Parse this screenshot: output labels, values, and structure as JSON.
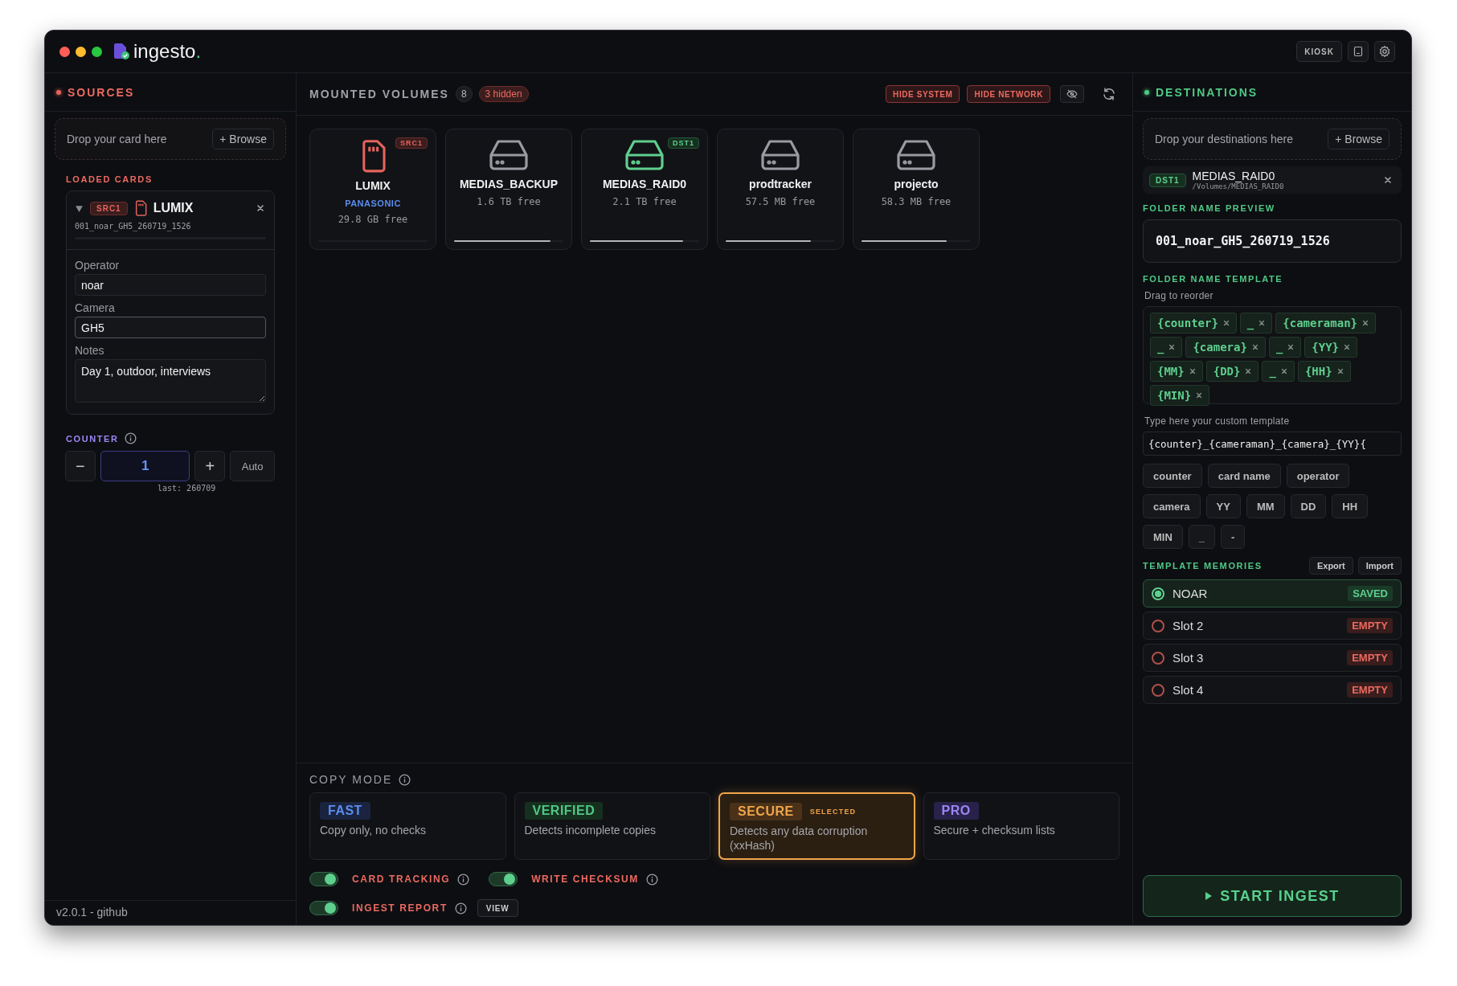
{
  "window": {
    "title": "ingesto",
    "title_mark": ".",
    "kiosk": "KIOSK"
  },
  "sources": {
    "title": "SOURCES",
    "drop_text": "Drop your card here",
    "browse": "+ Browse",
    "loaded_title": "LOADED CARDS",
    "cards": [
      {
        "badge": "SRC1",
        "name": "LUMIX",
        "folder": "001_noar_GH5_260719_1526",
        "expanded": true,
        "fields": [
          {
            "label": "Operator",
            "value": "noar",
            "kind": "input",
            "focused": false
          },
          {
            "label": "Camera",
            "value": "GH5",
            "kind": "input",
            "focused": true
          },
          {
            "label": "Notes",
            "value": "Day 1, outdoor, interviews",
            "kind": "textarea",
            "focused": false
          }
        ]
      }
    ],
    "counter": {
      "title": "COUNTER",
      "minus": "−",
      "value": "1",
      "plus": "+",
      "auto": "Auto",
      "last": "last: 260709"
    },
    "footer": "v2.0.1 - github"
  },
  "volumes": {
    "title": "MOUNTED VOLUMES",
    "count": "8",
    "hidden": "3 hidden",
    "filters": [
      "HIDE SYSTEM",
      "HIDE NETWORK"
    ],
    "items": [
      {
        "name": "LUMIX",
        "kind": "card",
        "vendor": "PANASONIC",
        "free": "29.8 GB free",
        "tag": {
          "label": "SRC1",
          "kind": "source"
        },
        "level": 0
      },
      {
        "name": "MEDIAS_BACKUP",
        "kind": "drive",
        "free": "1.6 TB free",
        "level": 0.88
      },
      {
        "name": "MEDIAS_RAID0",
        "kind": "drive",
        "free": "2.1 TB free",
        "tag": {
          "label": "DST1",
          "kind": "destination"
        },
        "level": 0.85
      },
      {
        "name": "prodtracker",
        "kind": "drive",
        "free": "57.5 MB free",
        "level": 0.78
      },
      {
        "name": "projecto",
        "kind": "drive",
        "free": "58.3 MB free",
        "level": 0.78
      }
    ]
  },
  "copy_mode": {
    "title": "COPY MODE",
    "selected_label": "SELECTED",
    "modes": [
      {
        "label": "FAST",
        "description": "Copy only, no checks",
        "kind": "fast",
        "selected": false
      },
      {
        "label": "VERIFIED",
        "description": "Detects incomplete copies",
        "kind": "verified",
        "selected": false
      },
      {
        "label": "SECURE",
        "description": "Detects any data corruption (xxHash)",
        "kind": "secure",
        "selected": true
      },
      {
        "label": "PRO",
        "description": "Secure + checksum lists",
        "kind": "pro",
        "selected": false
      }
    ],
    "toggles": [
      {
        "label": "CARD TRACKING",
        "on": true
      },
      {
        "label": "WRITE CHECKSUM",
        "on": true
      },
      {
        "label": "INGEST REPORT",
        "on": true,
        "action": "VIEW"
      }
    ]
  },
  "destinations": {
    "title": "DESTINATIONS",
    "drop_text": "Drop your destinations here",
    "browse": "+ Browse",
    "items": [
      {
        "badge": "DST1",
        "name": "MEDIAS_RAID0",
        "path": "/Volumes/MEDIAS_RAID0"
      }
    ],
    "preview_title": "FOLDER NAME PREVIEW",
    "preview": "001_noar_GH5_260719_1526",
    "template_title": "FOLDER NAME TEMPLATE",
    "template_hint": "Drag to reorder",
    "tokens": [
      "{counter}",
      "_",
      "{cameraman}",
      "_",
      "{camera}",
      "_",
      "{YY}",
      "{MM}",
      "{DD}",
      "_",
      "{HH}",
      "{MIN}"
    ],
    "custom_label": "Type here your custom template",
    "custom_value": "{counter}_{cameraman}_{camera}_{YY}{",
    "quick_tokens": [
      "counter",
      "card name",
      "operator",
      "camera",
      "YY",
      "MM",
      "DD",
      "HH",
      "MIN",
      "_",
      "-"
    ],
    "memories_title": "TEMPLATE MEMORIES",
    "export": "Export",
    "import": "Import",
    "slots": [
      {
        "name": "NOAR",
        "status": "SAVED",
        "kind": "saved",
        "selected": true
      },
      {
        "name": "Slot 2",
        "status": "EMPTY",
        "kind": "empty",
        "selected": false
      },
      {
        "name": "Slot 3",
        "status": "EMPTY",
        "kind": "empty",
        "selected": false
      },
      {
        "name": "Slot 4",
        "status": "EMPTY",
        "kind": "empty",
        "selected": false
      }
    ],
    "start": "START INGEST"
  }
}
